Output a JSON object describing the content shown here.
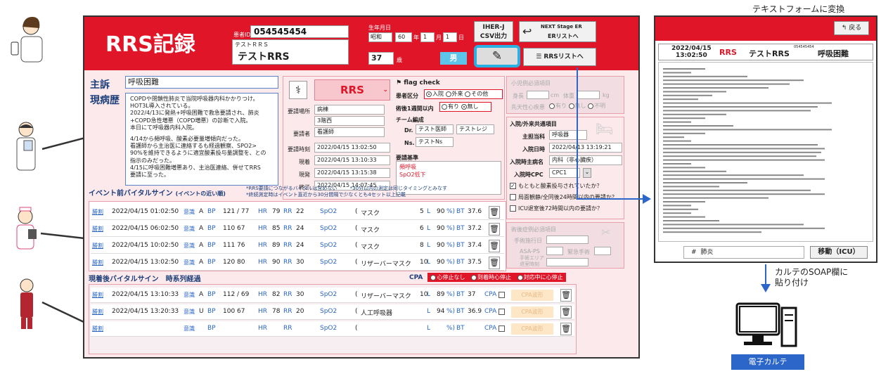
{
  "app": {
    "title": "RRS記録",
    "patient_id_label": "患者ID",
    "patient_id": "054545454",
    "kana_name": "テストＲＲＳ",
    "name": "テストRRS",
    "dob_label": "生年月日",
    "era": "昭和",
    "year": "60",
    "year_suffix": "年",
    "month": "1",
    "month_suffix": "月",
    "day": "1",
    "day_suffix": "日",
    "age": "37",
    "age_suffix": "歳",
    "sex": "男",
    "iher_label_1": "IHER-J",
    "iher_label_2": "CSV出力",
    "er_brand": "NEXT Stage ER",
    "er_link": "ERリストへ",
    "rrs_list": "RRSリストへ"
  },
  "complaint": {
    "chief_label": "主訴",
    "chief_value": "呼吸困難",
    "history_label": "現病歴",
    "history_lines": [
      "COPDや閉鎖性肺炎で当院呼吸器内科かかりつけ。",
      "HOT3L導入されている。",
      "2022/4/13に発熱+呼吸困難で救急要請され、肺炎",
      "+COPD急性増悪（COPD増悪）の診断で入院。",
      "本日にて呼吸器内科入院。",
      "",
      "4/14から頻呼吸、酸素必要量増傾向だった。",
      "看護師から主治医に連絡するも経過観察、SPO2>",
      "90%を維持できるように適宜酸素投与量調整を、との",
      "指示のみだった。",
      "4/15に呼吸困難増悪あり、主治医連絡、併せてRRS",
      "要請に至った。"
    ]
  },
  "request": {
    "rrs": "RRS",
    "place_label": "要請場所",
    "place_1": "病棟",
    "place_2": "3階西",
    "requester_label": "要請者",
    "requester": "看護師",
    "req_time_label": "要請時刻",
    "req_time": "2022/04/15 13:02:50",
    "arrive_label": "現着",
    "arrive_time": "2022/04/15 13:10:33",
    "depart_label": "現発",
    "depart_time": "2022/04/15 13:15:38",
    "end_label": "終了",
    "end_time": "2022/04/15 14:07:45"
  },
  "flag": {
    "title": "flag check",
    "category_label": "患者区分",
    "categories": [
      "入院",
      "外来",
      "その他"
    ],
    "surgery_label": "術後1週間以内",
    "surgery_options": [
      "有り",
      "無し"
    ],
    "team_label": "チーム編成",
    "dr_label": "Dr.",
    "dr_1": "テスト医師",
    "dr_2": "テストレジ",
    "ns_label": "Ns.",
    "ns_1": "テストNs",
    "criteria_label": "要請基準",
    "criteria_1": "頻呼吸",
    "criteria_2": "SpO2低下"
  },
  "pediatric": {
    "title": "小児例必須項目",
    "height_label": "身長",
    "height_unit": "cm",
    "weight_label": "体重",
    "weight_unit": "kg",
    "congenital_label": "先天性心疾患",
    "congenital_options": [
      "有り",
      "無し",
      "不明"
    ]
  },
  "admission": {
    "title": "入院/外来共通項目",
    "attending_label": "主担当科",
    "attending": "呼吸器",
    "admit_date_label": "入院日時",
    "admit_date": "2022/04/13 13:19:21",
    "diagnosis_label": "入院時主病名",
    "diagnosis": "内科（非心臓疾）",
    "cpc_label": "入院時CPC",
    "cpc": "CPC1",
    "q1": "もともと酸素投与されていたか？",
    "q2": "局面観静/全同後24時間以内の要請か？",
    "q3": "ICU退室後72時間以内の要請か？"
  },
  "postop": {
    "title": "術後症例必須項目",
    "surgery_date_label": "手術施行日",
    "asa_label": "ASA-PS",
    "urgent_label": "緊急手術",
    "anesthesia_label_1": "手術エリア",
    "anesthesia_label_2": "退室時刻"
  },
  "pre_vitals": {
    "title": "イベント前バイタルサイン",
    "subtitle": "(イベントの近い順)",
    "note_1": "*RRS要請につながるバイタルは含めない",
    "note_2": "*30分以内の測定は同じタイミングとみなす",
    "note_3": "*終続測定時はイベント直近から30分間隔で少なくとも4セット以上記載",
    "rows": [
      {
        "tag": "勝割",
        "time": "2022/04/15 01:02:50",
        "conscious": "A",
        "bp": "121 / 77",
        "hr": "79",
        "rr": "22",
        "o2": "マスク",
        "flow": "5",
        "spo2": "90",
        "bt": "37.6"
      },
      {
        "tag": "勝割",
        "time": "2022/04/15 06:02:50",
        "conscious": "A",
        "bp": "110 67",
        "hr": "85",
        "rr": "24",
        "o2": "マスク",
        "flow": "6",
        "spo2": "90",
        "bt": "37.2"
      },
      {
        "tag": "勝割",
        "time": "2022/04/15 10:02:50",
        "conscious": "A",
        "bp": "111 76",
        "hr": "89",
        "rr": "24",
        "o2": "マスク",
        "flow": "8",
        "spo2": "90",
        "bt": "37.4"
      },
      {
        "tag": "勝割",
        "time": "2022/04/15 13:02:50",
        "conscious": "A",
        "bp": "120 80",
        "hr": "90",
        "rr": "30",
        "o2": "リザーバーマスク",
        "flow": "10",
        "spo2": "90",
        "bt": "37.5"
      }
    ]
  },
  "post_vitals": {
    "title": "現着後バイタルサイン　時系列経過",
    "cpa_label": "CPA",
    "cpa_options": [
      "心停止なし",
      "到着時心停止",
      "対応中に心停止"
    ],
    "rows": [
      {
        "tag": "勝割",
        "time": "2022/04/15 13:10:33",
        "conscious": "A",
        "bp": "112 / 69",
        "hr": "82",
        "rr": "30",
        "o2": "リザーバーマスク",
        "flow": "10",
        "spo2": "89",
        "bt": "37"
      },
      {
        "tag": "勝割",
        "time": "2022/04/15 13:20:33",
        "conscious": "U",
        "bp": "100 67",
        "hr": "78",
        "rr": "20",
        "o2": "人工呼吸器",
        "flow": "",
        "spo2": "94",
        "bt": "36.9"
      },
      {
        "tag": "勝割",
        "time": "",
        "conscious": "",
        "bp": "",
        "hr": "",
        "rr": "",
        "o2": "",
        "flow": "",
        "spo2": "",
        "bt": ""
      }
    ]
  },
  "labels": {
    "conscious": "意識",
    "bp": "BP",
    "hr": "HR",
    "rr": "RR",
    "spo2": "SpO2",
    "l": "L",
    "pct": "%)",
    "bt": "BT",
    "cpa": "CPA",
    "cpa_waveform": "CPA波形"
  },
  "side": {
    "convert_label": "テキストフォームに変換",
    "back": "戻る",
    "date": "2022/04/15",
    "time": "13:02:50",
    "rrs": "RRS",
    "name": "テストRRS",
    "id": "054545454",
    "complaint": "呼吸困難",
    "hash": "#",
    "hash_value": "肺炎",
    "move_button": "移動（ICU）",
    "paste_label_1": "カルテのSOAP欄に",
    "paste_label_2": "貼り付け",
    "ehr_label": "電子カルテ"
  },
  "colors": {
    "brand_red": "#e01528",
    "blue": "#2b66c8",
    "panel_bg": "#fbe9ec"
  }
}
